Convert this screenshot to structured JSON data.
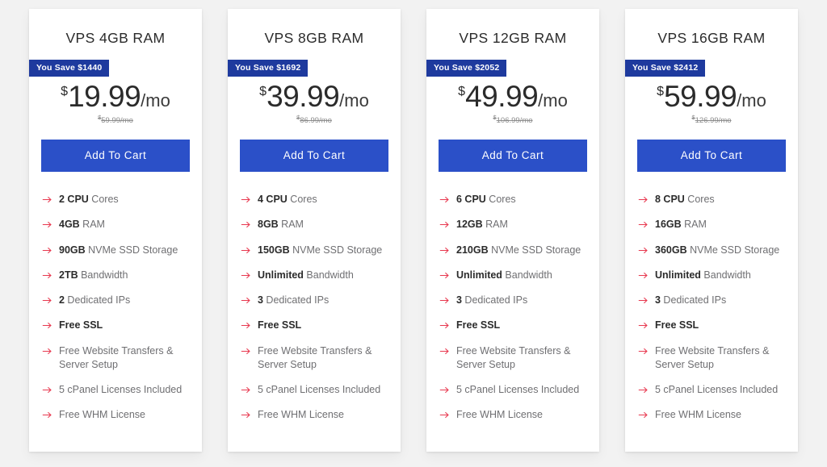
{
  "accent_colors": {
    "page_background": "#f2f2f2",
    "card_background": "#ffffff",
    "badge_background": "#1e3a9e",
    "button_background": "#2b50c8",
    "arrow_icon": "#e8384f",
    "title_text": "#2b2b2b",
    "feature_text": "#6f6f72",
    "old_price_text": "#8d8d8d"
  },
  "cards": [
    {
      "title": "VPS 4GB RAM",
      "badge": "You Save $1440",
      "currency": "$",
      "price": "19.99",
      "period": "/mo",
      "old_currency": "$",
      "old_price": "59.99/mo",
      "button_label": "Add To Cart",
      "features": [
        {
          "strong": "2 CPU",
          "rest": " Cores"
        },
        {
          "strong": "4GB",
          "rest": " RAM"
        },
        {
          "strong": "90GB",
          "rest": " NVMe SSD Storage"
        },
        {
          "strong": "2TB",
          "rest": " Bandwidth"
        },
        {
          "strong": "2",
          "rest": " Dedicated IPs"
        },
        {
          "strong": "Free SSL",
          "rest": ""
        },
        {
          "strong": "",
          "rest": "Free Website Transfers & Server Setup"
        },
        {
          "strong": "",
          "rest": "5 cPanel Licenses Included"
        },
        {
          "strong": "",
          "rest": "Free WHM License"
        }
      ]
    },
    {
      "title": "VPS 8GB RAM",
      "badge": "You Save $1692",
      "currency": "$",
      "price": "39.99",
      "period": "/mo",
      "old_currency": "$",
      "old_price": "86.99/mo",
      "button_label": "Add To Cart",
      "features": [
        {
          "strong": "4 CPU",
          "rest": " Cores"
        },
        {
          "strong": "8GB",
          "rest": " RAM"
        },
        {
          "strong": "150GB",
          "rest": " NVMe SSD Storage"
        },
        {
          "strong": "Unlimited",
          "rest": " Bandwidth"
        },
        {
          "strong": "3",
          "rest": " Dedicated IPs"
        },
        {
          "strong": "Free SSL",
          "rest": ""
        },
        {
          "strong": "",
          "rest": "Free Website Transfers & Server Setup"
        },
        {
          "strong": "",
          "rest": "5 cPanel Licenses Included"
        },
        {
          "strong": "",
          "rest": "Free WHM License"
        }
      ]
    },
    {
      "title": "VPS 12GB RAM",
      "badge": "You Save $2052",
      "currency": "$",
      "price": "49.99",
      "period": "/mo",
      "old_currency": "$",
      "old_price": "106.99/mo",
      "button_label": "Add To Cart",
      "features": [
        {
          "strong": "6 CPU",
          "rest": " Cores"
        },
        {
          "strong": "12GB",
          "rest": " RAM"
        },
        {
          "strong": "210GB",
          "rest": " NVMe SSD Storage"
        },
        {
          "strong": "Unlimited",
          "rest": " Bandwidth"
        },
        {
          "strong": "3",
          "rest": " Dedicated IPs"
        },
        {
          "strong": "Free SSL",
          "rest": ""
        },
        {
          "strong": "",
          "rest": "Free Website Transfers & Server Setup"
        },
        {
          "strong": "",
          "rest": "5 cPanel Licenses Included"
        },
        {
          "strong": "",
          "rest": "Free WHM License"
        }
      ]
    },
    {
      "title": "VPS 16GB RAM",
      "badge": "You Save $2412",
      "currency": "$",
      "price": "59.99",
      "period": "/mo",
      "old_currency": "$",
      "old_price": "126.99/mo",
      "button_label": "Add To Cart",
      "features": [
        {
          "strong": "8 CPU",
          "rest": " Cores"
        },
        {
          "strong": "16GB",
          "rest": " RAM"
        },
        {
          "strong": "360GB",
          "rest": " NVMe SSD Storage"
        },
        {
          "strong": "Unlimited",
          "rest": " Bandwidth"
        },
        {
          "strong": "3",
          "rest": " Dedicated IPs"
        },
        {
          "strong": "Free SSL",
          "rest": ""
        },
        {
          "strong": "",
          "rest": "Free Website Transfers & Server Setup"
        },
        {
          "strong": "",
          "rest": "5 cPanel Licenses Included"
        },
        {
          "strong": "",
          "rest": "Free WHM License"
        }
      ]
    }
  ]
}
